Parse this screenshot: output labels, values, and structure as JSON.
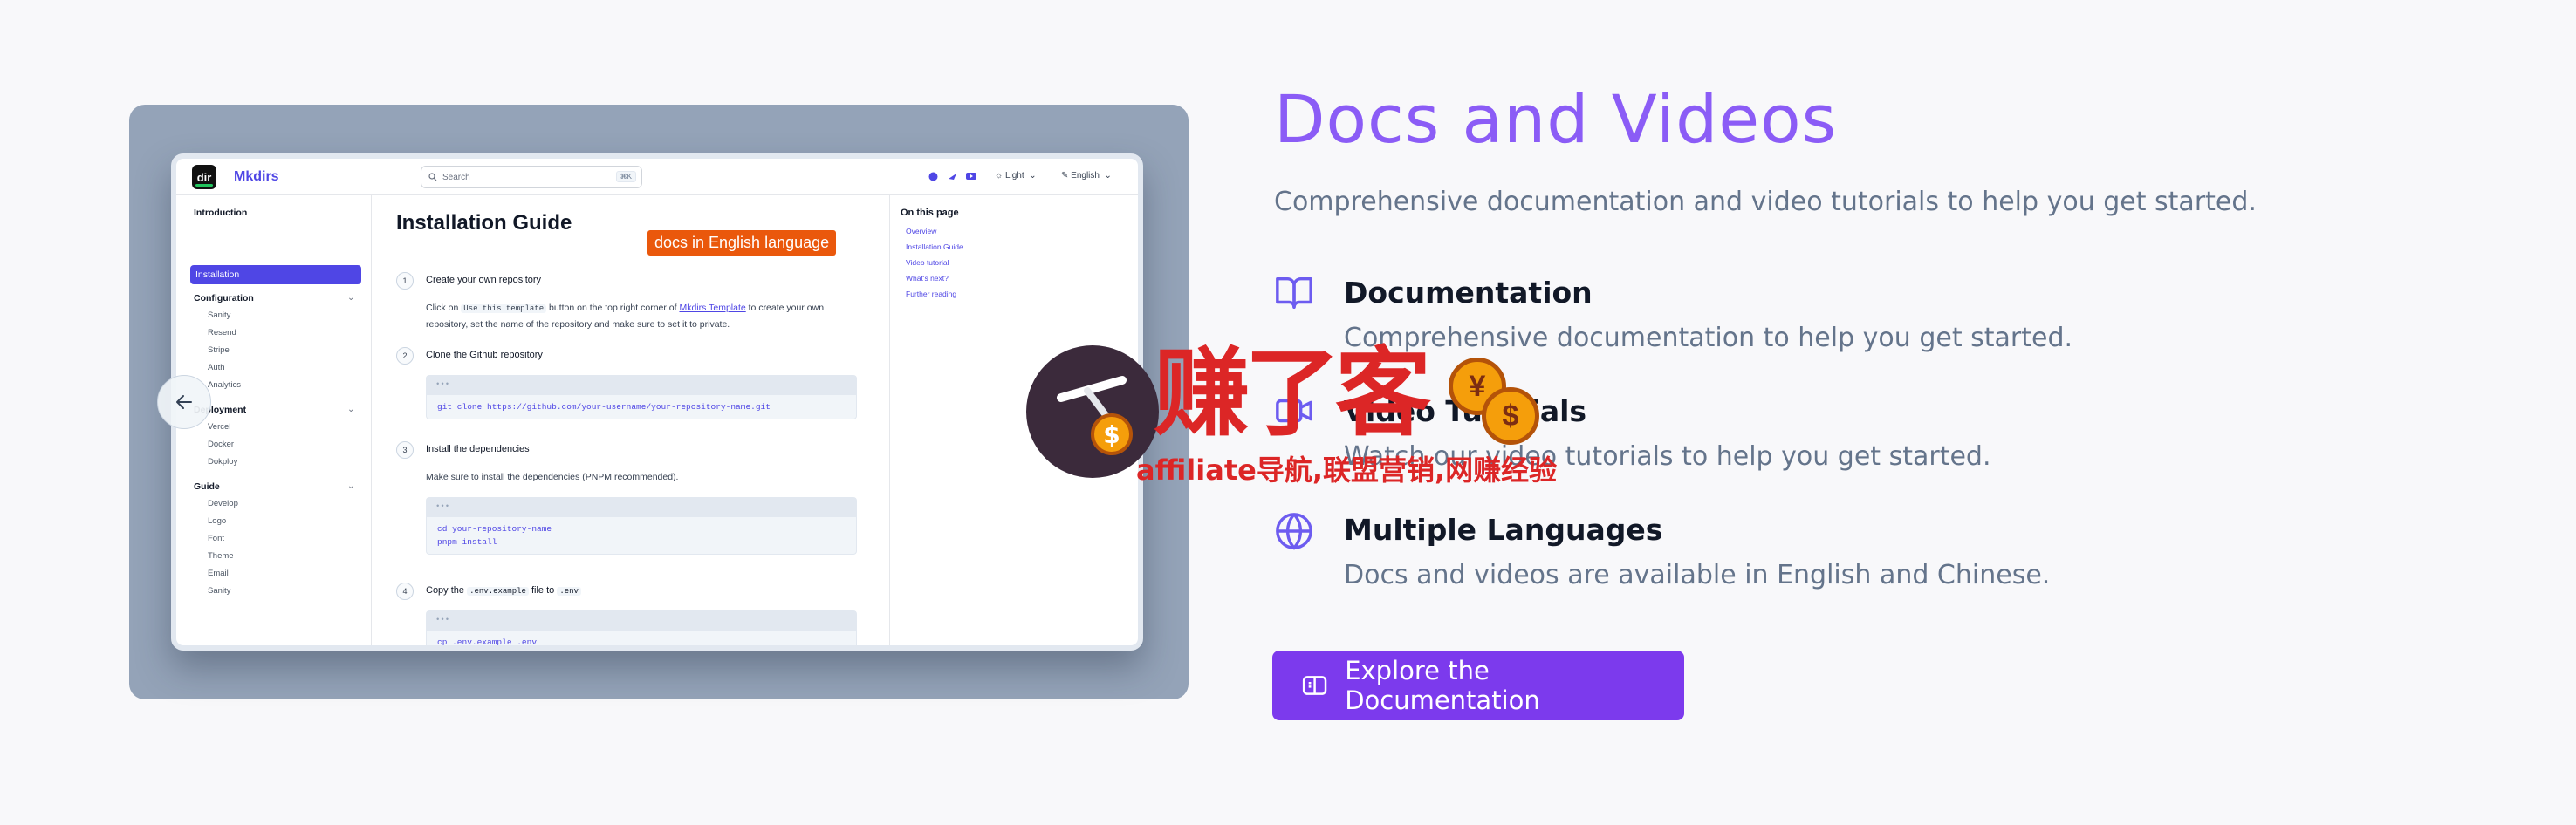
{
  "screenshot": {
    "brand": "Mkdirs",
    "logo_text": "dir",
    "search_placeholder": "Search",
    "search_shortcut": "⌘K",
    "theme_label": "Light",
    "language_label": "English",
    "sidebar": {
      "introduction": "Introduction",
      "installation": "Installation",
      "configuration": "Configuration",
      "configuration_items": [
        "Sanity",
        "Resend",
        "Stripe",
        "Auth",
        "Analytics"
      ],
      "deployment": "Deployment",
      "deployment_items": [
        "Vercel",
        "Docker",
        "Dokploy"
      ],
      "guide": "Guide",
      "guide_items": [
        "Develop",
        "Logo",
        "Font",
        "Theme",
        "Email",
        "Sanity"
      ]
    },
    "doc": {
      "title": "Installation Guide",
      "steps": [
        {
          "n": "1",
          "title": "Create your own repository"
        },
        {
          "n": "2",
          "title": "Clone the Github repository"
        },
        {
          "n": "3",
          "title": "Install the dependencies"
        },
        {
          "n": "4",
          "title": "Copy the"
        }
      ],
      "step1_text_a": "Click on",
      "step1_code": "Use this template",
      "step1_text_b": "button on the top right corner of",
      "step1_link": "Mkdirs Template",
      "step1_text_c": "to create your",
      "step1_text_d": "own repository, set the name of the repository and make sure to set it to private.",
      "step2_code": "git clone https://github.com/your-username/your-repository-name.git",
      "step3_text": "Make sure to install the dependencies (PNPM recommended).",
      "step3_code_1": "cd your-repository-name",
      "step3_code_2": "pnpm install",
      "step4_code_a": ".env.example",
      "step4_mid": "file to",
      "step4_code_b": ".env",
      "step4_block": "cp .env.example .env",
      "code_bar": "•••"
    },
    "toc": {
      "heading": "On this page",
      "items": [
        "Overview",
        "Installation Guide",
        "Video tutorial",
        "What's next?",
        "Further reading"
      ]
    },
    "annotation": "docs in English language"
  },
  "section": {
    "title": "Docs and Videos",
    "subtitle": "Comprehensive documentation and video tutorials to help you get started.",
    "features": [
      {
        "title": "Documentation",
        "desc": "Comprehensive documentation to help you get started.",
        "icon": "book-open-icon"
      },
      {
        "title": "Video Tutorials",
        "desc": "Watch our video tutorials to help you get started.",
        "icon": "video-icon"
      },
      {
        "title": "Multiple Languages",
        "desc": "Docs and videos are available in English and Chinese.",
        "icon": "globe-icon"
      }
    ],
    "cta_label": "Explore the Documentation"
  },
  "watermark": {
    "main": "赚了客",
    "sub": "affiliate导航,联盟营销,网赚经验"
  },
  "colors": {
    "accent": "#8b5cf6",
    "button": "#7c3aed",
    "indigo": "#4f46e5",
    "annotation": "#ea580c"
  }
}
